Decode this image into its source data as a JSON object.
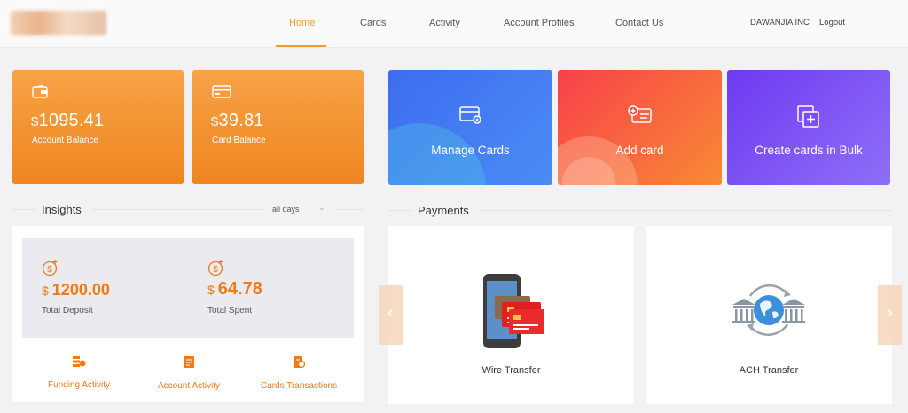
{
  "nav": {
    "items": [
      {
        "label": "Home",
        "active": true
      },
      {
        "label": "Cards",
        "active": false
      },
      {
        "label": "Activity",
        "active": false
      },
      {
        "label": "Account Profiles",
        "active": false
      },
      {
        "label": "Contact Us",
        "active": false
      }
    ],
    "company": "DAWANJIA INC",
    "logout": "Logout",
    "accent_color": "#f39a2e"
  },
  "balances": {
    "account": {
      "currency": "$",
      "amount": "1095.41",
      "label": "Account Balance",
      "icon": "wallet-icon"
    },
    "card": {
      "currency": "$",
      "amount": "39.81",
      "label": "Card Balance",
      "icon": "credit-card-icon"
    }
  },
  "actions": [
    {
      "label": "Manage Cards",
      "icon": "manage-cards-icon",
      "color": "#3d6df0"
    },
    {
      "label": "Add card",
      "icon": "add-card-icon",
      "color": "#f7414b"
    },
    {
      "label": "Create cards in Bulk",
      "icon": "bulk-cards-icon",
      "color": "#6f3af1"
    }
  ],
  "insights": {
    "title": "Insights",
    "filter": "all days",
    "deposit": {
      "currency": "$",
      "amount": "1200.00",
      "label": "Total Deposit"
    },
    "spent": {
      "currency": "$",
      "amount": "64.78",
      "label": "Total Spent"
    },
    "links": [
      {
        "label": "Funding Activity",
        "icon": "funding-icon"
      },
      {
        "label": "Account Activity",
        "icon": "document-icon"
      },
      {
        "label": "Cards Transactions",
        "icon": "transactions-icon"
      }
    ]
  },
  "payments": {
    "title": "Payments",
    "items": [
      {
        "label": "Wire Transfer",
        "icon": "phone-cards-icon"
      },
      {
        "label": "ACH Transfer",
        "icon": "globe-banks-icon"
      }
    ]
  }
}
